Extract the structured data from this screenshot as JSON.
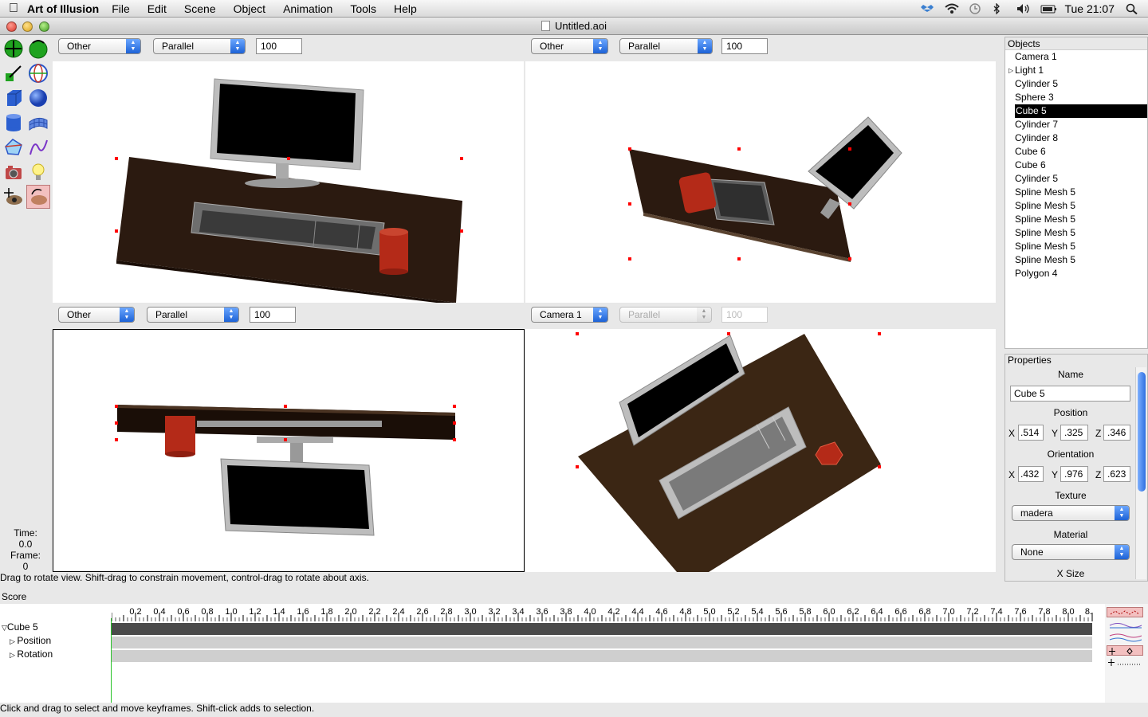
{
  "menubar": {
    "app_name": "Art of Illusion",
    "menus": [
      "File",
      "Edit",
      "Scene",
      "Object",
      "Animation",
      "Tools",
      "Help"
    ],
    "clock": "Tue 21:07"
  },
  "window": {
    "title": "Untitled.aoi"
  },
  "tools": [
    {
      "name": "move-tool-icon"
    },
    {
      "name": "rotate-tool-icon"
    },
    {
      "name": "skew-tool-icon"
    },
    {
      "name": "scale-tool-icon"
    },
    {
      "name": "cube-tool-icon"
    },
    {
      "name": "sphere-tool-icon"
    },
    {
      "name": "cylinder-tool-icon"
    },
    {
      "name": "spline-mesh-tool-icon"
    },
    {
      "name": "polygon-tool-icon"
    },
    {
      "name": "curve-tool-icon"
    },
    {
      "name": "camera-tool-icon"
    },
    {
      "name": "light-tool-icon"
    },
    {
      "name": "move-view-tool-icon"
    },
    {
      "name": "rotate-view-tool-icon"
    }
  ],
  "viewports": [
    {
      "view": "Other",
      "projection": "Parallel",
      "scale": "100"
    },
    {
      "view": "Other",
      "projection": "Parallel",
      "scale": "100"
    },
    {
      "view": "Other",
      "projection": "Parallel",
      "scale": "100"
    },
    {
      "view": "Camera 1",
      "projection": "Parallel",
      "scale": "100"
    }
  ],
  "time_info": {
    "time_label": "Time:",
    "time_value": "0.0",
    "frame_label": "Frame:",
    "frame_value": "0"
  },
  "status_top": "Drag to rotate view.  Shift-drag to constrain movement, control-drag to rotate about axis.",
  "objects": {
    "header": "Objects",
    "items": [
      "Camera 1",
      "Light 1",
      "Cylinder 5",
      "Sphere 3",
      "Cube 5",
      "Cylinder 7",
      "Cylinder 8",
      "Cube 6",
      "Cube 6",
      "Cylinder 5",
      "Spline Mesh 5",
      "Spline Mesh 5",
      "Spline Mesh 5",
      "Spline Mesh 5",
      "Spline Mesh 5",
      "Spline Mesh 5",
      "Polygon 4"
    ],
    "selected_index": 4
  },
  "properties": {
    "header": "Properties",
    "name_label": "Name",
    "name_value": "Cube 5",
    "position_label": "Position",
    "position": {
      "x": ".514",
      "y": ".325",
      "z": ".346"
    },
    "orientation_label": "Orientation",
    "orientation": {
      "x": ".432",
      "y": ".976",
      "z": ".623"
    },
    "axis_x": "X",
    "axis_y": "Y",
    "axis_z": "Z",
    "texture_label": "Texture",
    "texture_value": "madera",
    "material_label": "Material",
    "material_value": "None",
    "xsize_label": "X Size"
  },
  "score": {
    "label": "Score",
    "ruler_ticks": [
      "0.2",
      "0.4",
      "0.6",
      "0.8",
      "1.0",
      "1.2",
      "1.4",
      "1.6",
      "1.8",
      "2.0",
      "2.2",
      "2.4",
      "2.6",
      "2.8",
      "3.0",
      "3.2",
      "3.4",
      "3.6",
      "3.8",
      "4.0",
      "4.2",
      "4.4",
      "4.6",
      "4.8",
      "5.0",
      "5.2",
      "5.4",
      "5.6",
      "5.8",
      "6.0",
      "6.2",
      "6.4",
      "6.6",
      "6.8",
      "7.0",
      "7.2",
      "7.4",
      "7.6",
      "7.8",
      "8.0",
      "8."
    ],
    "tracks": {
      "object": "Cube 5",
      "position": "Position",
      "rotation": "Rotation"
    }
  },
  "status_bottom": "Click and drag to select and move keyframes.  Shift-click adds to selection.",
  "colors": {
    "desk": "#2b1a10",
    "mug": "#b42a18",
    "monitor_frame": "#bdbdbd",
    "selection_handle": "#ff0000",
    "accent_blue": "#2f6fe0"
  }
}
